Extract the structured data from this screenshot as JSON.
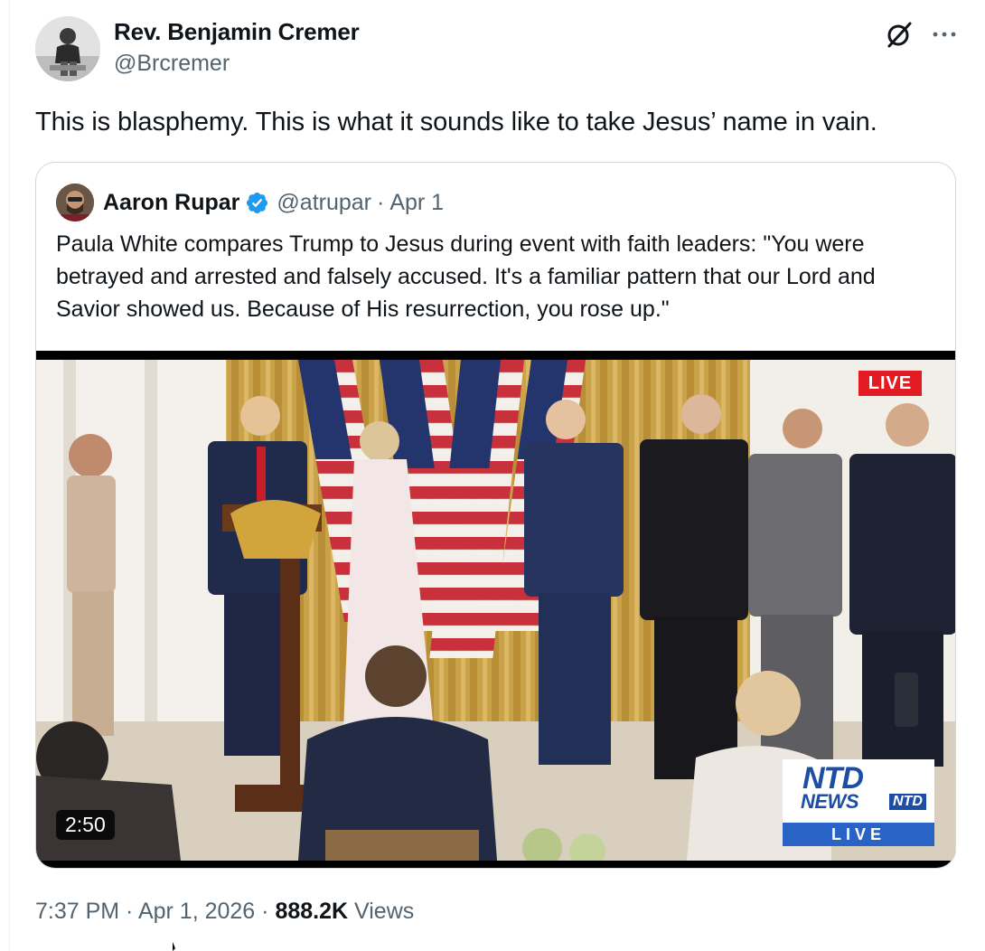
{
  "author": {
    "name": "Rev. Benjamin Cremer",
    "handle": "@Brcremer"
  },
  "tweet_text": "This is blasphemy. This is what it sounds like to take Jesus’ name in vain.",
  "quoted": {
    "name": "Aaron Rupar",
    "handle": "@atrupar",
    "separator": "·",
    "date": "Apr 1",
    "text": "Paula White compares Trump to Jesus during event with faith leaders: \"You were betrayed and arrested and falsely accused. It's a familiar pattern that our Lord and Savior showed us. Because of His resurrection, you rose up.\"",
    "video": {
      "duration": "2:50",
      "live_badge": "LIVE",
      "logo": {
        "line1": "NTD",
        "line2": "NEWS",
        "small": "NTD",
        "live": "LIVE"
      }
    }
  },
  "meta": {
    "time": "7:37 PM",
    "sep1": " · ",
    "date": "Apr 1, 2026",
    "sep2": " · ",
    "views_count": "888.2K",
    "views_label": " Views"
  },
  "colors": {
    "text": "#0f1419",
    "secondary": "#536471",
    "verified": "#1d9bf0",
    "border": "#cfd9de"
  },
  "icons": [
    "grok-icon",
    "more-icon",
    "verified-badge-icon"
  ]
}
